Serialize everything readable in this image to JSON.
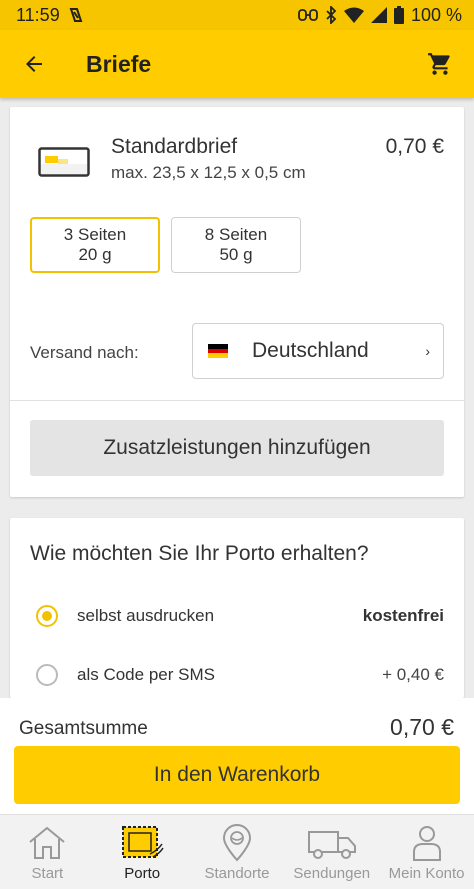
{
  "status_bar": {
    "time": "11:59",
    "battery": "100 %"
  },
  "app_bar": {
    "title": "Briefe",
    "icons": [
      "arrow-left-icon",
      "shopping-cart-icon"
    ]
  },
  "product": {
    "name": "Standardbrief",
    "dimensions": "max. 23,5 x 12,5 x 0,5 cm",
    "price": "0,70 €",
    "options": [
      {
        "line1": "3 Seiten",
        "line2": "20 g",
        "selected": true
      },
      {
        "line1": "8 Seiten",
        "line2": "50 g",
        "selected": false
      }
    ],
    "shipping_label": "Versand nach:",
    "country": "Deutschland",
    "addon_button": "Zusatzleistungen hinzufügen"
  },
  "porto": {
    "question": "Wie möchten Sie Ihr Porto erhalten?",
    "choices": [
      {
        "label": "selbst ausdrucken",
        "price": "kostenfrei",
        "selected": true
      },
      {
        "label": "als Code per SMS",
        "price": "+ 0,40 €",
        "selected": false
      }
    ]
  },
  "total": {
    "label": "Gesamtsumme",
    "value": "0,70 €",
    "button": "In den Warenkorb"
  },
  "bottom_nav": {
    "items": [
      {
        "label": "Start",
        "icon": "home-icon",
        "active": false
      },
      {
        "label": "Porto",
        "icon": "stamp-icon",
        "active": true
      },
      {
        "label": "Standorte",
        "icon": "location-pin-icon",
        "active": false
      },
      {
        "label": "Sendungen",
        "icon": "truck-icon",
        "active": false
      },
      {
        "label": "Mein Konto",
        "icon": "person-icon",
        "active": false
      }
    ]
  },
  "colors": {
    "brand_yellow": "#ffcc00",
    "status_bar": "#f6c500",
    "flag_black": "#000000",
    "flag_red": "#dd0000",
    "flag_gold": "#ffce00"
  }
}
